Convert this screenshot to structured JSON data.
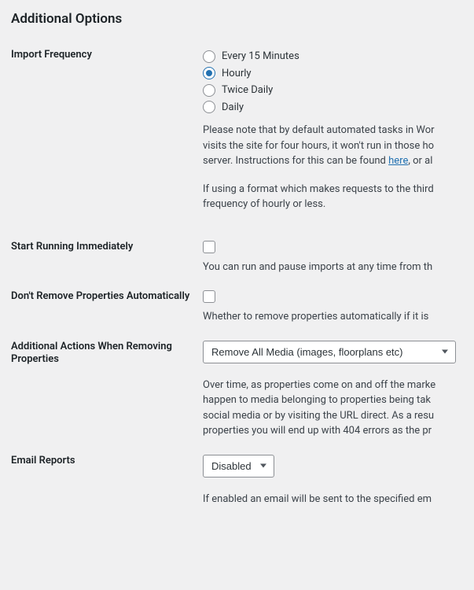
{
  "heading": "Additional Options",
  "fields": {
    "import_frequency": {
      "label": "Import Frequency",
      "options": [
        "Every 15 Minutes",
        "Hourly",
        "Twice Daily",
        "Daily"
      ],
      "selected": "Hourly",
      "note1_a": "Please note that by default automated tasks in Wor",
      "note1_b": "visits the site for four hours, it won't run in those ho",
      "note1_c": "server. Instructions for this can be found ",
      "note1_link": "here",
      "note1_d": ", or al",
      "note2": "If using a format which makes requests to the third",
      "note3": "frequency of hourly or less."
    },
    "start_immediately": {
      "label": "Start Running Immediately",
      "desc": "You can run and pause imports at any time from th"
    },
    "dont_remove": {
      "label": "Don't Remove Properties Automatically",
      "desc": "Whether to remove properties automatically if it is "
    },
    "additional_actions": {
      "label": "Additional Actions When Removing Properties",
      "selected": "Remove All Media (images, floorplans etc)",
      "desc_a": "Over time, as properties come on and off the marke",
      "desc_b": "happen to media belonging to properties being tak",
      "desc_c": "social media or by visiting the URL direct. As a resu",
      "desc_d": "properties you will end up with 404 errors as the pr"
    },
    "email_reports": {
      "label": "Email Reports",
      "selected": "Disabled",
      "desc": "If enabled an email will be sent to the specified em"
    }
  }
}
